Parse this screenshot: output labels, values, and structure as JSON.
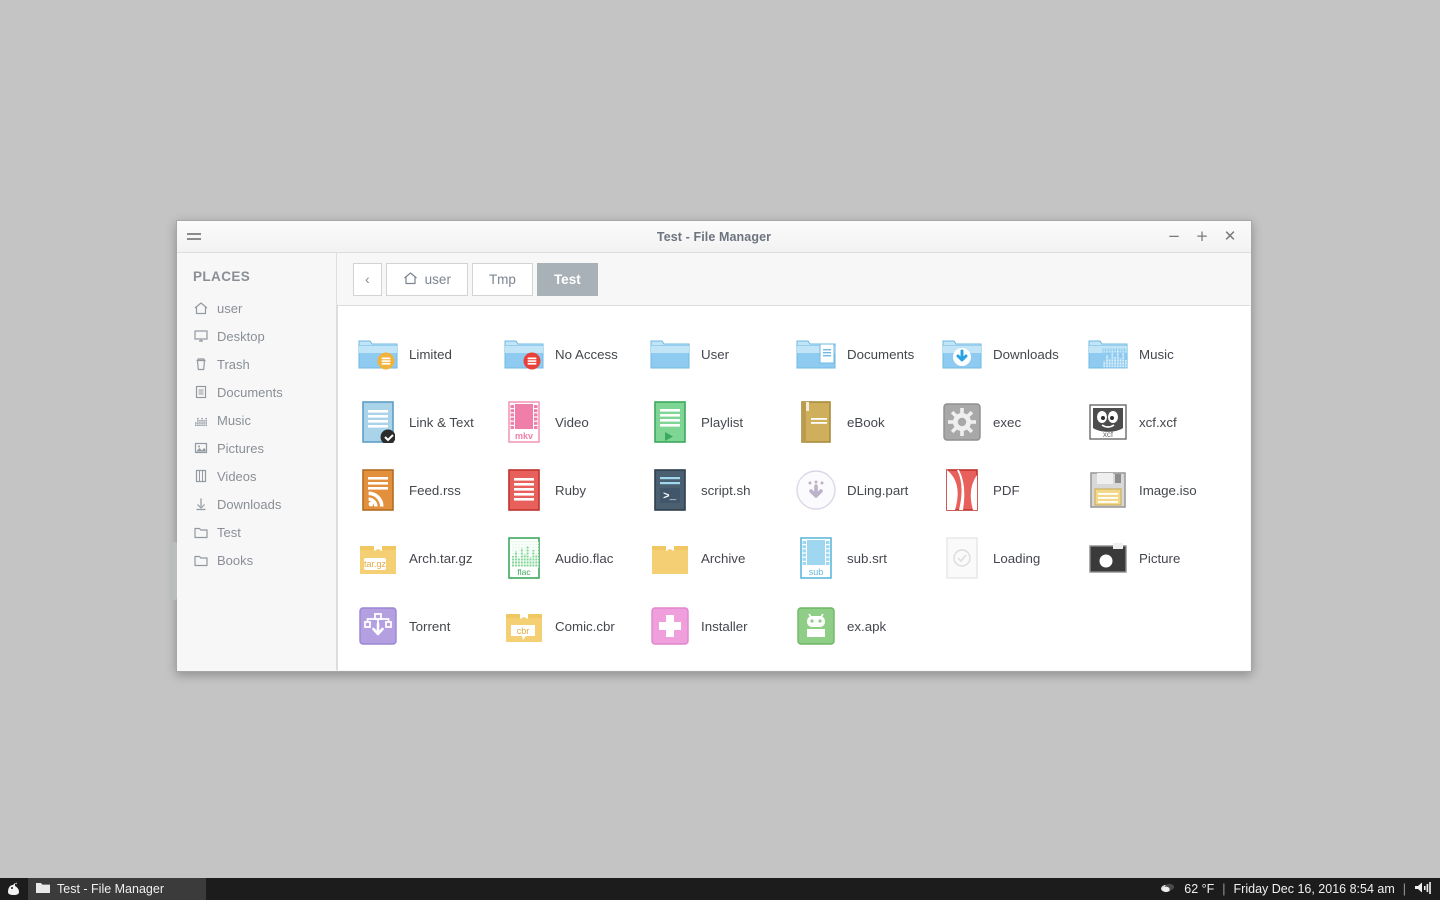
{
  "window": {
    "title": "Test - File Manager",
    "menu_icon": "hamburger-menu-icon",
    "buttons": {
      "minimize": "−",
      "maximize": "+",
      "close": "✕"
    }
  },
  "sidebar": {
    "heading": "PLACES",
    "items": [
      {
        "label": "user",
        "icon": "home-icon"
      },
      {
        "label": "Desktop",
        "icon": "monitor-icon"
      },
      {
        "label": "Trash",
        "icon": "trash-icon"
      },
      {
        "label": "Documents",
        "icon": "document-icon"
      },
      {
        "label": "Music",
        "icon": "music-icon"
      },
      {
        "label": "Pictures",
        "icon": "picture-icon"
      },
      {
        "label": "Videos",
        "icon": "video-icon"
      },
      {
        "label": "Downloads",
        "icon": "download-arrow-icon"
      },
      {
        "label": "Test",
        "icon": "folder-icon"
      },
      {
        "label": "Books",
        "icon": "folder-icon"
      }
    ]
  },
  "pathbar": {
    "back_label": "‹",
    "crumbs": [
      {
        "label": "user",
        "icon": "home-icon",
        "active": false
      },
      {
        "label": "Tmp",
        "icon": "",
        "active": false
      },
      {
        "label": "Test",
        "icon": "",
        "active": true
      }
    ]
  },
  "files": [
    {
      "label": "Limited",
      "icon": "folder-limited-icon"
    },
    {
      "label": "No Access",
      "icon": "folder-noaccess-icon"
    },
    {
      "label": "User",
      "icon": "folder-icon"
    },
    {
      "label": "Documents",
      "icon": "folder-documents-icon"
    },
    {
      "label": "Downloads",
      "icon": "folder-downloads-icon"
    },
    {
      "label": "Music",
      "icon": "folder-music-icon"
    },
    {
      "label": "Link & Text",
      "icon": "text-link-icon"
    },
    {
      "label": "Video",
      "icon": "video-mkv-icon"
    },
    {
      "label": "Playlist",
      "icon": "playlist-icon"
    },
    {
      "label": "eBook",
      "icon": "ebook-icon"
    },
    {
      "label": "exec",
      "icon": "executable-gear-icon"
    },
    {
      "label": "xcf.xcf",
      "icon": "xcf-gimp-icon"
    },
    {
      "label": "Feed.rss",
      "icon": "rss-feed-icon"
    },
    {
      "label": "Ruby",
      "icon": "ruby-icon"
    },
    {
      "label": "script.sh",
      "icon": "shell-script-icon"
    },
    {
      "label": "DLing.part",
      "icon": "downloading-part-icon"
    },
    {
      "label": "PDF",
      "icon": "pdf-icon"
    },
    {
      "label": "Image.iso",
      "icon": "disk-image-icon"
    },
    {
      "label": "Arch.tar.gz",
      "icon": "archive-targz-icon"
    },
    {
      "label": "Audio.flac",
      "icon": "audio-flac-icon"
    },
    {
      "label": "Archive",
      "icon": "archive-box-icon"
    },
    {
      "label": "sub.srt",
      "icon": "subtitle-icon"
    },
    {
      "label": "Loading",
      "icon": "loading-icon"
    },
    {
      "label": "Picture",
      "icon": "photo-camera-icon"
    },
    {
      "label": "Torrent",
      "icon": "torrent-icon"
    },
    {
      "label": "Comic.cbr",
      "icon": "comic-cbr-icon"
    },
    {
      "label": "Installer",
      "icon": "installer-package-icon"
    },
    {
      "label": "ex.apk",
      "icon": "android-apk-icon"
    }
  ],
  "taskbar": {
    "menu_icon": "start-menu-icon",
    "task": {
      "label": "Test - File Manager",
      "icon": "folder-icon"
    },
    "tray": {
      "weather_icon": "cloud-icon",
      "temperature": "62 °F",
      "separator": "|",
      "datetime": "Friday Dec 16, 2016  8:54 am",
      "volume_icon": "speaker-icon"
    }
  },
  "colors": {
    "desktop": "#c4c4c4",
    "window_bg": "#f7f7f7",
    "accent_active_crumb": "#a8b0b8",
    "folder_blue": "#8fcbf0",
    "taskbar": "#1c1c1c"
  }
}
